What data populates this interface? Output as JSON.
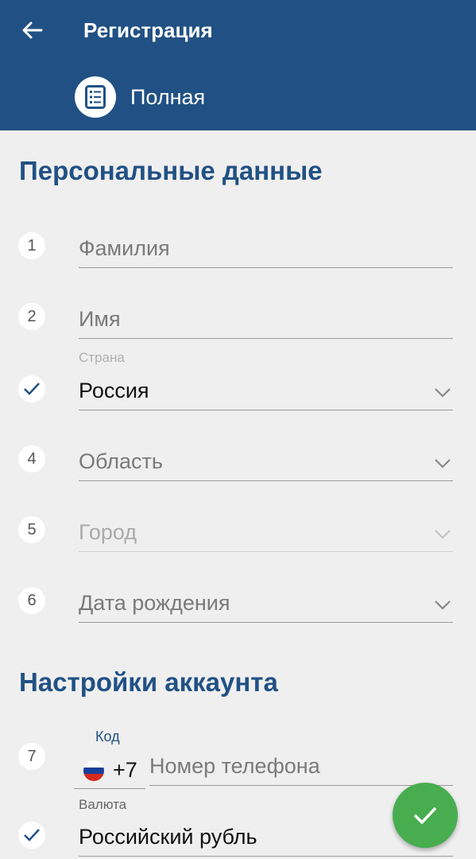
{
  "appbar": {
    "title": "Регистрация",
    "mode_label": "Полная"
  },
  "sections": {
    "personal": "Персональные данные",
    "account": "Настройки аккаунта"
  },
  "fields": {
    "last_name": {
      "step": "1",
      "placeholder": "Фамилия"
    },
    "first_name": {
      "step": "2",
      "placeholder": "Имя"
    },
    "country": {
      "label": "Страна",
      "value": "Россия"
    },
    "region": {
      "step": "4",
      "placeholder": "Область"
    },
    "city": {
      "step": "5",
      "placeholder": "Город"
    },
    "birth_date": {
      "step": "6",
      "placeholder": "Дата рождения"
    },
    "phone": {
      "step": "7",
      "code_label": "Код",
      "code": "+7",
      "placeholder": "Номер телефона"
    },
    "currency": {
      "label": "Валюта",
      "value": "Российский рубль"
    }
  },
  "colors": {
    "primary": "#215184",
    "fab": "#47ad4f",
    "background": "#efefef"
  }
}
